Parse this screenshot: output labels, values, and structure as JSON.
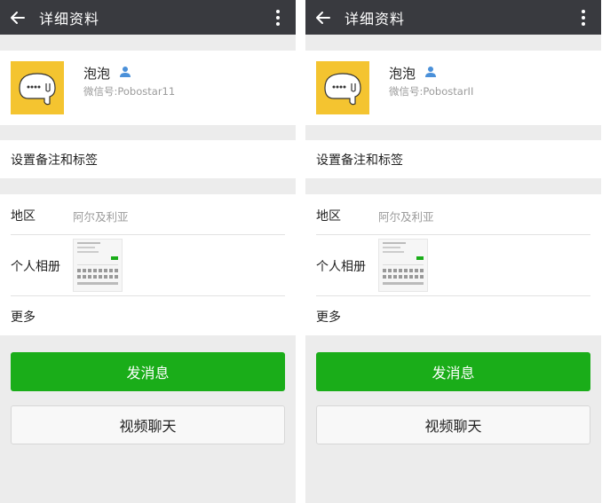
{
  "screens": [
    {
      "header": {
        "title": "详细资料",
        "back_icon": "arrow-left-icon",
        "more_icon": "more-vertical-icon"
      },
      "profile": {
        "name": "泡泡",
        "wechat_id": "微信号:Pobostar11",
        "gender_icon": "person-icon",
        "avatar_color": "#f4c430"
      },
      "remark_row": {
        "label": "设置备注和标签"
      },
      "info": {
        "region_label": "地区",
        "region_value": "阿尔及利亚",
        "album_label": "个人相册",
        "more_label": "更多"
      },
      "buttons": {
        "send_message": "发消息",
        "video_chat": "视频聊天"
      }
    },
    {
      "header": {
        "title": "详细资料",
        "back_icon": "arrow-left-icon",
        "more_icon": "more-vertical-icon"
      },
      "profile": {
        "name": "泡泡",
        "wechat_id": "微信号:PobostarII",
        "gender_icon": "person-icon",
        "avatar_color": "#f4c430"
      },
      "remark_row": {
        "label": "设置备注和标签"
      },
      "info": {
        "region_label": "地区",
        "region_value": "阿尔及利亚",
        "album_label": "个人相册",
        "more_label": "更多"
      },
      "buttons": {
        "send_message": "发消息",
        "video_chat": "视频聊天"
      }
    }
  ],
  "colors": {
    "topbar": "#393a3f",
    "primary_button": "#1aad19",
    "background": "#ececec",
    "gender_icon": "#4a90d9"
  }
}
